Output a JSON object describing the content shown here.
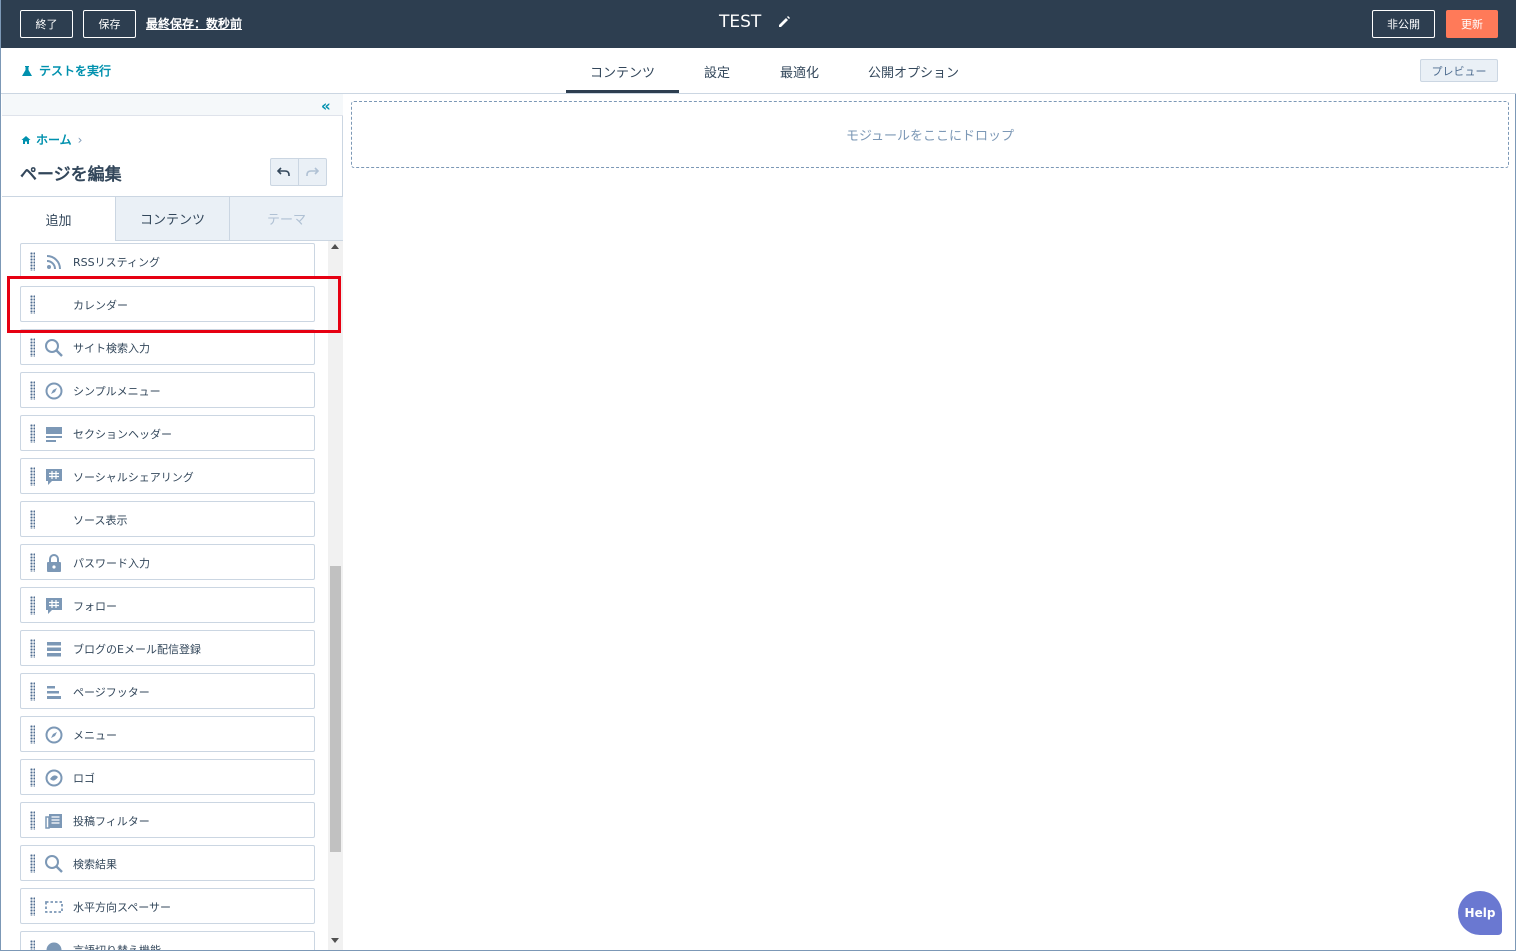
{
  "topbar": {
    "exit_label": "終了",
    "save_label": "保存",
    "last_saved": "最終保存：数秒前",
    "title": "TEST",
    "unpublish_label": "非公開",
    "update_label": "更新"
  },
  "subbar": {
    "run_test": "テストを実行",
    "tabs": [
      {
        "label": "コンテンツ",
        "active": true
      },
      {
        "label": "設定"
      },
      {
        "label": "最適化"
      },
      {
        "label": "公開オプション"
      }
    ],
    "preview_label": "プレビュー"
  },
  "sidebar": {
    "breadcrumb_home": "ホーム",
    "breadcrumb_sep": "›",
    "title": "ページを編集",
    "tabs": [
      {
        "label": "追加",
        "active": true
      },
      {
        "label": "コンテンツ"
      },
      {
        "label": "テーマ",
        "disabled": true
      }
    ],
    "modules": [
      {
        "label": "RSSリスティング",
        "icon": "rss-icon"
      },
      {
        "label": "カレンダー",
        "icon": "none"
      },
      {
        "label": "サイト検索入力",
        "icon": "search-icon"
      },
      {
        "label": "シンプルメニュー",
        "icon": "compass-icon"
      },
      {
        "label": "セクションヘッダー",
        "icon": "section-header-icon"
      },
      {
        "label": "ソーシャルシェアリング",
        "icon": "hashtag-bubble-icon"
      },
      {
        "label": "ソース表示",
        "icon": "none"
      },
      {
        "label": "パスワード入力",
        "icon": "lock-icon"
      },
      {
        "label": "フォロー",
        "icon": "hashtag-bubble-icon"
      },
      {
        "label": "ブログのEメール配信登録",
        "icon": "form-icon"
      },
      {
        "label": "ページフッター",
        "icon": "footer-icon"
      },
      {
        "label": "メニュー",
        "icon": "compass-icon"
      },
      {
        "label": "ロゴ",
        "icon": "logo-icon"
      },
      {
        "label": "投稿フィルター",
        "icon": "newspaper-icon"
      },
      {
        "label": "検索結果",
        "icon": "search-icon"
      },
      {
        "label": "水平方向スペーサー",
        "icon": "spacer-icon"
      },
      {
        "label": "言語切り替え機能",
        "icon": "globe-icon"
      }
    ]
  },
  "canvas": {
    "dropzone_text": "モジュールをここにドロップ"
  },
  "help_label": "Help",
  "colors": {
    "topbar_bg": "#2d3e50",
    "accent": "#0091ae",
    "update_button": "#ff7a59",
    "highlight_box": "#e60012",
    "help_button": "#6a78d1"
  }
}
